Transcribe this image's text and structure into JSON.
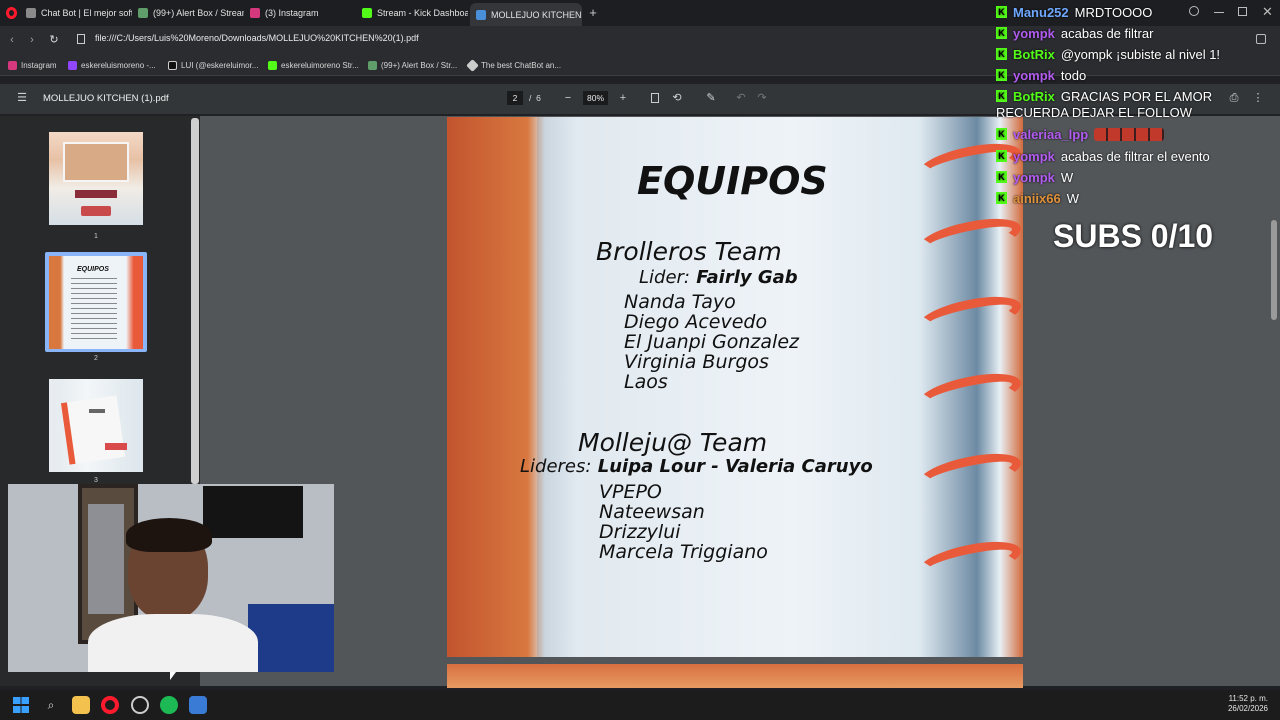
{
  "browser": {
    "tabs": [
      {
        "label": "Chat Bot | El mejor softwa",
        "color": "#8a8a8a"
      },
      {
        "label": "(99+) Alert Box / Streamla",
        "color": "#5f9d6a"
      },
      {
        "label": "(3) Instagram",
        "color": "#d6387e"
      },
      {
        "label": "Stream - Kick Dashboard",
        "color": "#53fc18"
      },
      {
        "label": "MOLLEJUO KITCHEN (1).p",
        "color": "#4a90d9"
      }
    ],
    "new_tab": "+",
    "url": "file:///C:/Users/Luis%20Moreno/Downloads/MOLLEJUO%20KITCHEN%20(1).pdf",
    "bookmarks": [
      {
        "label": "Instagram",
        "color": "#d6387e"
      },
      {
        "label": "eskereluismoreno -...",
        "color": "#9146ff"
      },
      {
        "label": "LUI (@eskereluimor...",
        "color": "#111111"
      },
      {
        "label": "eskereluimoreno Str...",
        "color": "#53fc18"
      },
      {
        "label": "(99+) Alert Box / Str...",
        "color": "#5f9d6a"
      },
      {
        "label": "The best ChatBot an...",
        "color": "#cccccc"
      }
    ]
  },
  "pdf": {
    "title": "MOLLEJUO KITCHEN (1).pdf",
    "current_page": "2",
    "page_separator": "/",
    "total_pages": "6",
    "zoom": "80%",
    "thumbnails": [
      "1",
      "2",
      "3"
    ],
    "content": {
      "heading": "EQUIPOS",
      "team1_name": "Brolleros Team",
      "team1_leader_label": "Lider:",
      "team1_leader": "Fairly Gab",
      "team1_members": [
        "Nanda Tayo",
        "Diego Acevedo",
        "El Juanpi Gonzalez",
        "Virginia Burgos",
        "Laos"
      ],
      "team2_name": "Molleju@ Team",
      "team2_leader_label": "Lideres:",
      "team2_leader": "Luipa Lour - Valeria Caruyo",
      "team2_members": [
        "VPEPO",
        "Nateewsan",
        "Drizzylui",
        "Marcela Triggiano"
      ]
    }
  },
  "chat": {
    "messages": [
      {
        "user": "Manu252",
        "text": "MRDTOOOO",
        "color": "#6fa8ff"
      },
      {
        "user": "yompk",
        "text": "acabas de filtrar",
        "color": "#b25cf0"
      },
      {
        "user": "BotRix",
        "text": "@yompk ¡subiste al nivel 1!",
        "color": "#53fc18"
      },
      {
        "user": "yompk",
        "text": "todo",
        "color": "#b25cf0"
      },
      {
        "user": "BotRix",
        "text": "GRACIAS POR EL AMOR",
        "color": "#53fc18"
      },
      {
        "user": "",
        "text": "RECUERDA DEJAR EL FOLLOW",
        "color": "#ffffff"
      },
      {
        "user": "valeriaa_lpp",
        "text": "",
        "color": "#b25cf0"
      },
      {
        "user": "yompk",
        "text": "acabas de filtrar el evento",
        "color": "#b25cf0"
      },
      {
        "user": "yompk",
        "text": "W",
        "color": "#b25cf0"
      },
      {
        "user": "ainiix66",
        "text": "W",
        "color": "#e0913a"
      }
    ],
    "subs": "SUBS 0/10"
  },
  "taskbar": {
    "time": "11:52 p. m.",
    "date": "26/02/2026"
  }
}
